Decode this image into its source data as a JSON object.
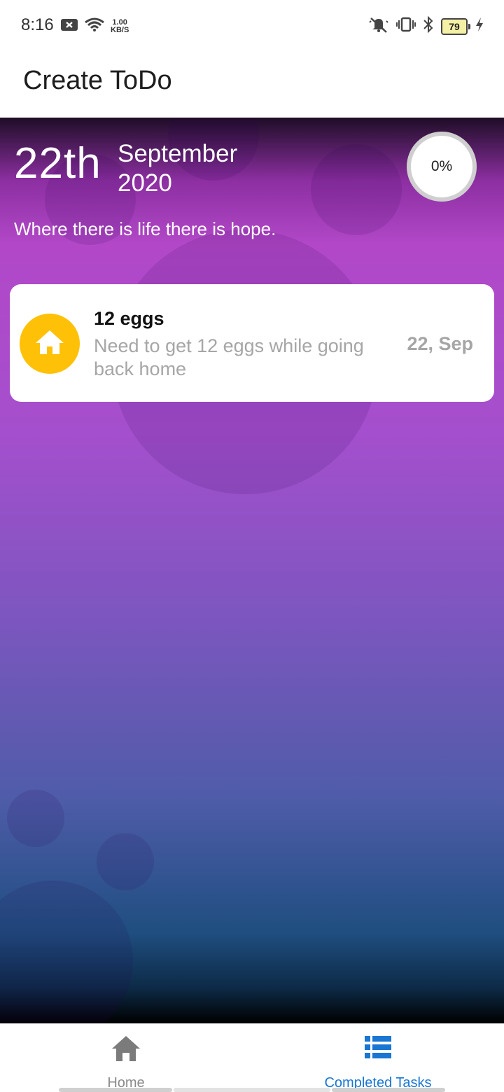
{
  "status_bar": {
    "time": "8:16",
    "net_speed_value": "1.00",
    "net_speed_unit": "KB/S",
    "battery_level": "79",
    "icons": [
      "notification-x-icon",
      "wifi-icon",
      "silent-icon",
      "vibrate-icon",
      "bluetooth-icon",
      "battery-icon",
      "charging-icon"
    ]
  },
  "app_bar": {
    "title": "Create ToDo"
  },
  "header": {
    "day": "22th",
    "month": "September",
    "year": "2020",
    "progress": "0%",
    "quote": "Where there is life there is hope."
  },
  "tasks": [
    {
      "title": "12 eggs",
      "description": "Need to get 12 eggs while going back home",
      "date": "22, Sep",
      "icon": "home-icon",
      "icon_color": "#ffc107"
    }
  ],
  "bottom_nav": {
    "items": [
      {
        "label": "Home",
        "icon": "home-icon",
        "active": false
      },
      {
        "label": "Completed Tasks",
        "icon": "list-icon",
        "active": true
      }
    ]
  },
  "colors": {
    "accent": "#1976d2",
    "task_icon_bg": "#ffc107",
    "gradient_top": "#b248c8",
    "gradient_bottom": "#1f4e80"
  }
}
